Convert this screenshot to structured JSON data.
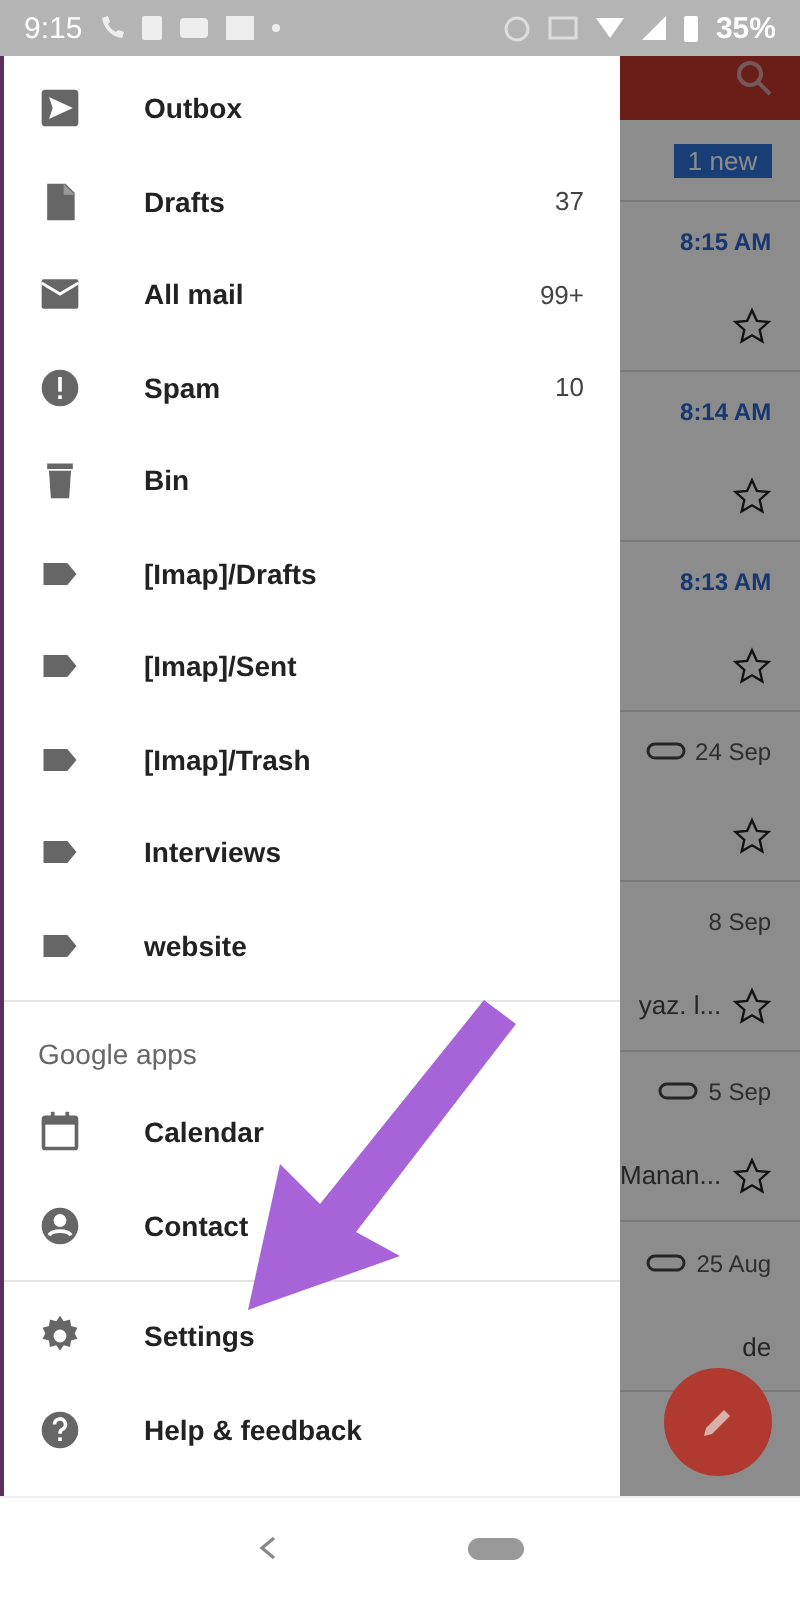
{
  "status_bar": {
    "time": "9:15",
    "battery": "35%"
  },
  "drawer": {
    "items": [
      {
        "label": "Outbox"
      },
      {
        "label": "Drafts",
        "count": "37"
      },
      {
        "label": "All mail",
        "count": "99+"
      },
      {
        "label": "Spam",
        "count": "10"
      },
      {
        "label": "Bin"
      },
      {
        "label": "[Imap]/Drafts"
      },
      {
        "label": "[Imap]/Sent"
      },
      {
        "label": "[Imap]/Trash"
      },
      {
        "label": "Interviews"
      },
      {
        "label": "website"
      }
    ],
    "section_title": "Google apps",
    "apps": [
      "Calendar",
      "Contact"
    ],
    "footer": [
      "Settings",
      "Help & feedback"
    ]
  },
  "mail_list": {
    "new_badge": "1 new",
    "rows": [
      {
        "date": "8:15 AM",
        "unread": true,
        "attachment": false,
        "star": true
      },
      {
        "date": "8:14 AM",
        "unread": true,
        "attachment": false,
        "star": true
      },
      {
        "date": "8:13 AM",
        "unread": true,
        "attachment": false,
        "star": true
      },
      {
        "date": "24 Sep",
        "unread": false,
        "attachment": true,
        "star": true
      },
      {
        "date": "8 Sep",
        "unread": false,
        "attachment": false,
        "snippet": "yaz. l...",
        "star": true
      },
      {
        "date": "5 Sep",
        "unread": false,
        "attachment": true,
        "snippet": "Manan...",
        "star": true
      },
      {
        "date": "25 Aug",
        "unread": false,
        "attachment": true,
        "snippet": "de",
        "star": false
      }
    ]
  }
}
